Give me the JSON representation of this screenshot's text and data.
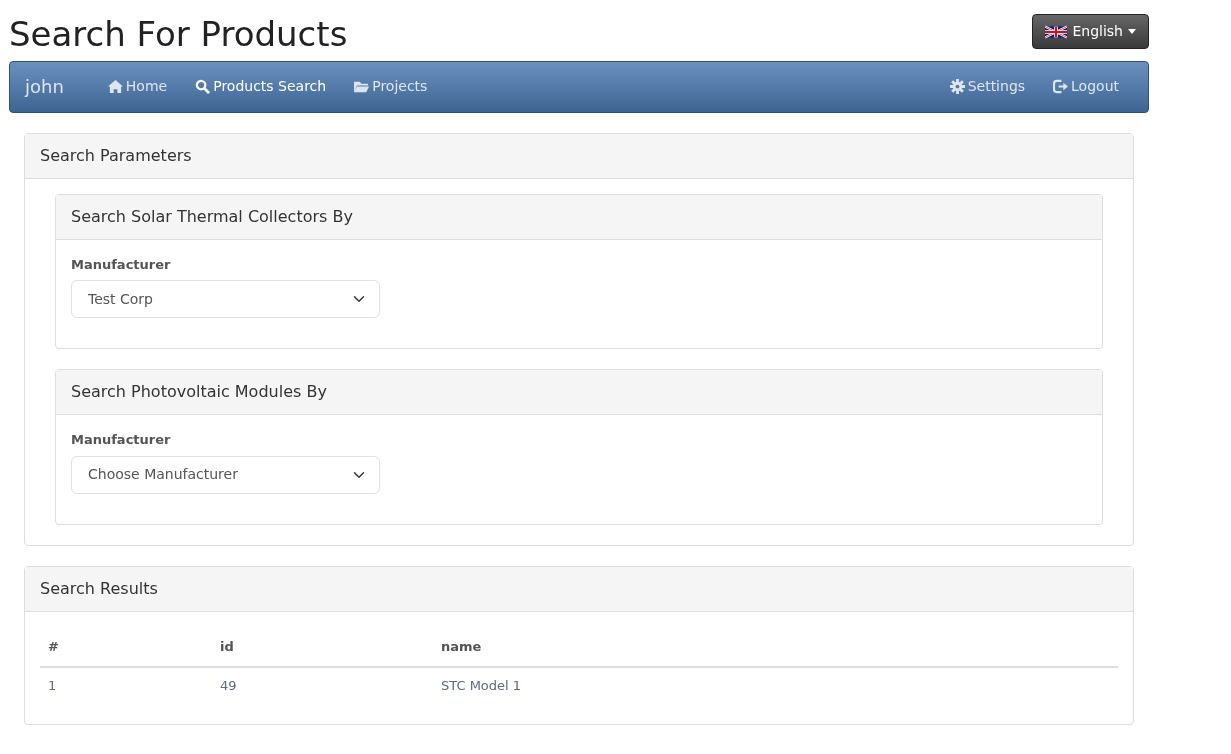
{
  "page_title": "Search For Products",
  "language_button": {
    "label": "English"
  },
  "navbar": {
    "brand": "john",
    "left_items": [
      {
        "label": "Home",
        "selected": false
      },
      {
        "label": "Products Search",
        "selected": true
      },
      {
        "label": "Projects",
        "selected": false
      }
    ],
    "right_items": [
      {
        "label": "Settings"
      },
      {
        "label": "Logout"
      }
    ]
  },
  "search_parameters": {
    "title": "Search Parameters",
    "sections": [
      {
        "title": "Search Solar Thermal Collectors By",
        "field_label": "Manufacturer",
        "value": "Test Corp"
      },
      {
        "title": "Search Photovoltaic Modules By",
        "field_label": "Manufacturer",
        "value": "Choose Manufacturer"
      }
    ]
  },
  "search_results": {
    "title": "Search Results",
    "columns": [
      "#",
      "id",
      "name"
    ],
    "rows": [
      [
        "1",
        "49",
        "STC Model 1"
      ]
    ]
  }
}
